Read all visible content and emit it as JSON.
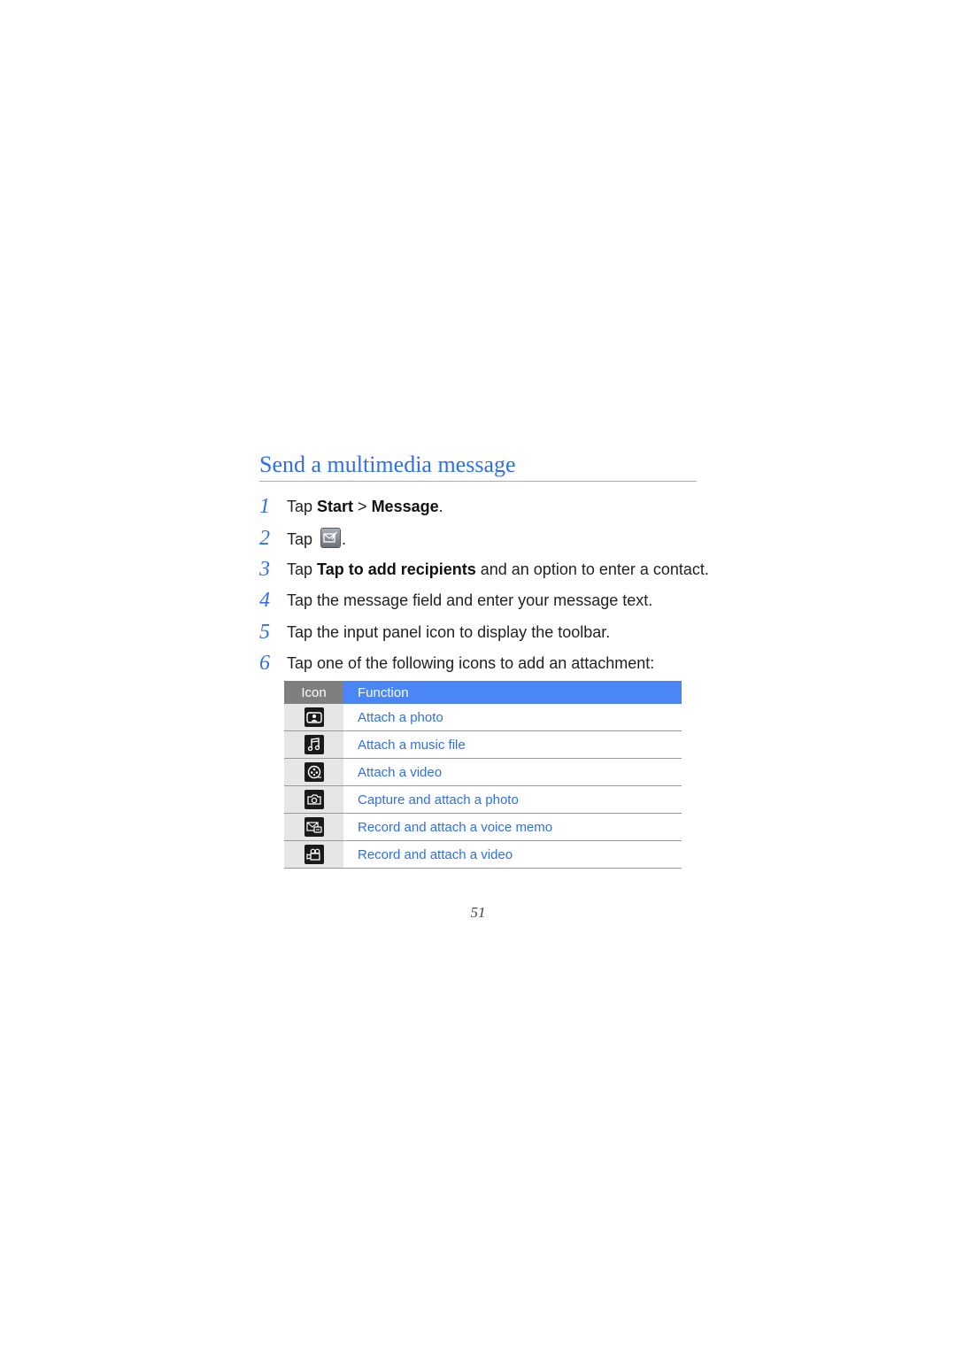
{
  "section": {
    "title": "Send a multimedia message",
    "accent_color": "#2f6fe9"
  },
  "steps": [
    {
      "num": "1",
      "pre": "Tap ",
      "bold1": "Start",
      "mid": " > ",
      "bold2": "Message",
      "post": "."
    },
    {
      "num": "2",
      "pre": "Tap ",
      "icon": "compose-message-icon",
      "post": "."
    },
    {
      "num": "3",
      "pre": "Tap ",
      "bold1": "Tap to add recipients",
      "post": " and an option to enter a contact."
    },
    {
      "num": "4",
      "text": "Tap the message field and enter your message text."
    },
    {
      "num": "5",
      "text": "Tap the input panel icon to display the toolbar."
    },
    {
      "num": "6",
      "text": "Tap one of the following icons to add an attachment:"
    }
  ],
  "table": {
    "headers": {
      "icon": "Icon",
      "function": "Function"
    },
    "header_colors": {
      "icon": "#7f7f7f",
      "function": "#4a86f5"
    },
    "rows": [
      {
        "icon": "attach-photo-icon",
        "function": "Attach a photo"
      },
      {
        "icon": "attach-music-icon",
        "function": "Attach a music file"
      },
      {
        "icon": "attach-video-icon",
        "function": "Attach a video"
      },
      {
        "icon": "camera-icon",
        "function": "Capture and attach a photo"
      },
      {
        "icon": "voice-memo-icon",
        "function": "Record and attach a voice memo"
      },
      {
        "icon": "video-camera-icon",
        "function": "Record and attach a video"
      }
    ]
  },
  "page_number": "51"
}
